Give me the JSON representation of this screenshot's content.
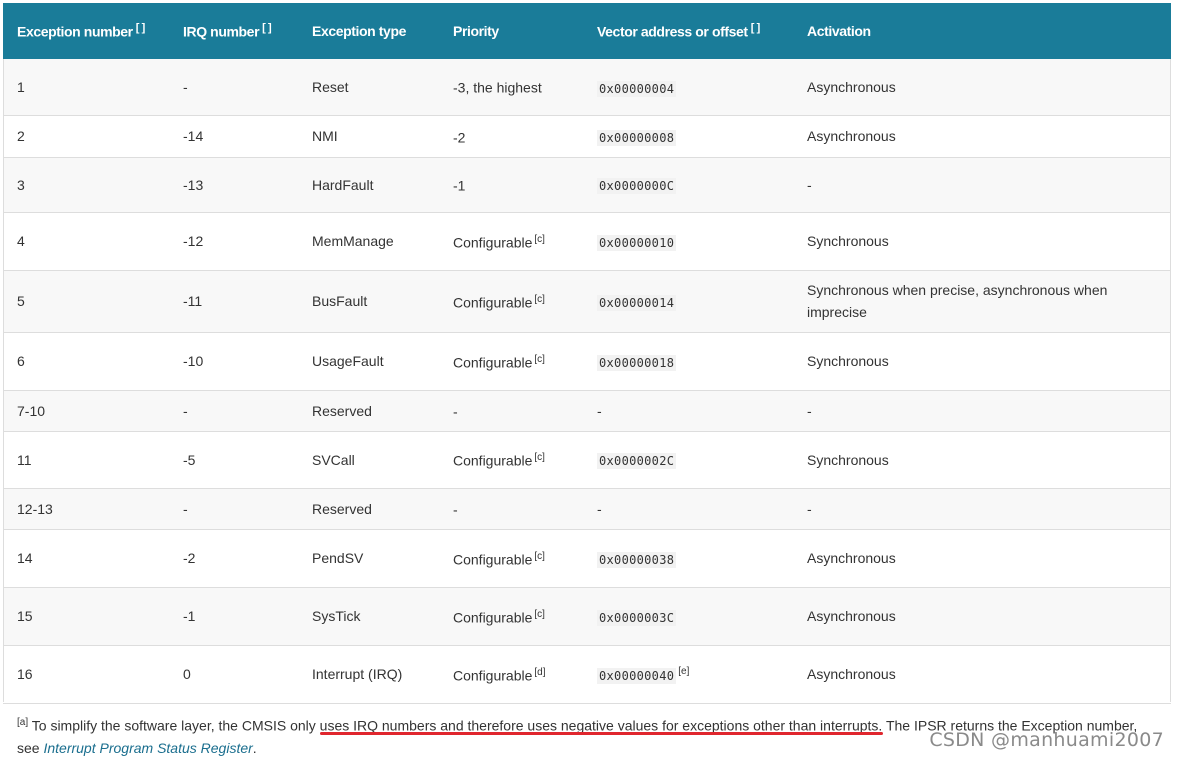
{
  "headers": [
    {
      "label": "Exception number",
      "sup": "[ ]"
    },
    {
      "label": "IRQ number",
      "sup": "[ ]"
    },
    {
      "label": "Exception type",
      "sup": ""
    },
    {
      "label": "Priority",
      "sup": ""
    },
    {
      "label": "Vector address or offset",
      "sup": "[ ]"
    },
    {
      "label": "Activation",
      "sup": ""
    }
  ],
  "rows": [
    {
      "num": "1",
      "irq": "-",
      "type": "Reset",
      "priority": "-3, the highest",
      "priority_sup": "",
      "vector": "0x00000004",
      "vector_sup": "",
      "activation": "Asynchronous"
    },
    {
      "num": "2",
      "irq": "-14",
      "type": "NMI",
      "priority": "-2",
      "priority_sup": "",
      "vector": "0x00000008",
      "vector_sup": "",
      "activation": "Asynchronous"
    },
    {
      "num": "3",
      "irq": "-13",
      "type": "HardFault",
      "priority": "-1",
      "priority_sup": "",
      "vector": "0x0000000C",
      "vector_sup": "",
      "activation": "-"
    },
    {
      "num": "4",
      "irq": "-12",
      "type": "MemManage",
      "priority": "Configurable",
      "priority_sup": "[c]",
      "vector": "0x00000010",
      "vector_sup": "",
      "activation": "Synchronous"
    },
    {
      "num": "5",
      "irq": "-11",
      "type": "BusFault",
      "priority": "Configurable",
      "priority_sup": "[c]",
      "vector": "0x00000014",
      "vector_sup": "",
      "activation": "Synchronous when precise, asynchronous when imprecise"
    },
    {
      "num": "6",
      "irq": "-10",
      "type": "UsageFault",
      "priority": "Configurable",
      "priority_sup": "[c]",
      "vector": "0x00000018",
      "vector_sup": "",
      "activation": "Synchronous"
    },
    {
      "num": "7-10",
      "irq": "-",
      "type": "Reserved",
      "priority": "-",
      "priority_sup": "",
      "vector": "-",
      "vector_sup": "",
      "activation": "-"
    },
    {
      "num": "11",
      "irq": "-5",
      "type": "SVCall",
      "priority": "Configurable",
      "priority_sup": "[c]",
      "vector": "0x0000002C",
      "vector_sup": "",
      "activation": "Synchronous"
    },
    {
      "num": "12-13",
      "irq": "-",
      "type": "Reserved",
      "priority": "-",
      "priority_sup": "",
      "vector": "-",
      "vector_sup": "",
      "activation": "-"
    },
    {
      "num": "14",
      "irq": "-2",
      "type": "PendSV",
      "priority": "Configurable",
      "priority_sup": "[c]",
      "vector": "0x00000038",
      "vector_sup": "",
      "activation": "Asynchronous"
    },
    {
      "num": "15",
      "irq": "-1",
      "type": "SysTick",
      "priority": "Configurable",
      "priority_sup": "[c]",
      "vector": "0x0000003C",
      "vector_sup": "",
      "activation": "Asynchronous"
    },
    {
      "num": "16",
      "irq": "0",
      "type": "Interrupt (IRQ)",
      "priority": "Configurable",
      "priority_sup": "[d]",
      "vector": "0x00000040",
      "vector_sup": "[e]",
      "activation": "Asynchronous"
    }
  ],
  "footnote": {
    "sup": "[a]",
    "text_before": " To simplify the software layer, the CMSIS only ",
    "underlined": "uses IRQ numbers and therefore uses negative values for exceptions other than interrupts",
    "text_after": ". The IPSR returns the Exception number, see ",
    "link": "Interrupt Program Status Register",
    "end": "."
  },
  "watermark": "CSDN @manhuami2007",
  "colors": {
    "header_bg": "#1a7c99",
    "underline": "#e0262e",
    "link": "#1a6e8e"
  }
}
